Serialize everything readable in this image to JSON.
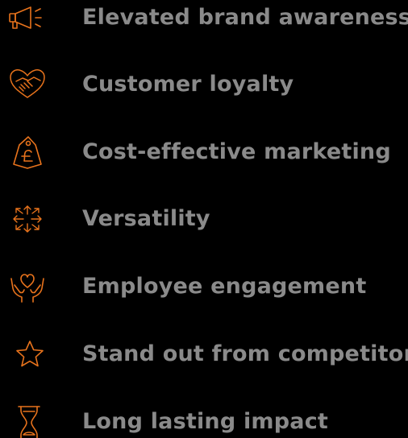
{
  "colors": {
    "background": "#000000",
    "accent": "#e8731c",
    "text": "#8a8a8a"
  },
  "benefits": [
    {
      "label": "Elevated brand awareness",
      "icon": "megaphone-icon"
    },
    {
      "label": "Customer loyalty",
      "icon": "handshake-heart-icon"
    },
    {
      "label": "Cost-effective marketing",
      "icon": "pound-price-tag-icon"
    },
    {
      "label": "Versatility",
      "icon": "expand-arrows-icon"
    },
    {
      "label": "Employee engagement",
      "icon": "hands-heart-icon"
    },
    {
      "label": "Stand out from competitors",
      "icon": "star-icon"
    },
    {
      "label": "Long lasting impact",
      "icon": "hourglass-icon"
    }
  ]
}
